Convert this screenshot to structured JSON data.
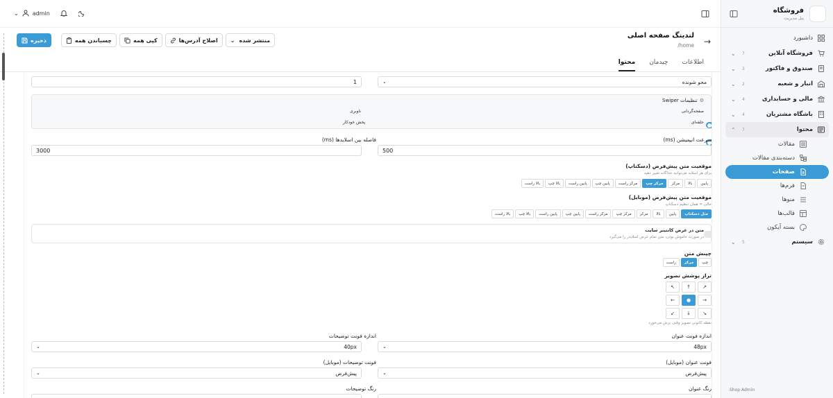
{
  "brand": {
    "name": "فروشگاه",
    "subtitle": "پنل مدیریت"
  },
  "topbar": {
    "username": "admin"
  },
  "sidebar": {
    "top_items": [
      {
        "label": "داشبورد",
        "icon": "grid-icon"
      }
    ],
    "groups": [
      {
        "label": "فروشگاه آنلاین",
        "count": "7"
      },
      {
        "label": "صندوق و فاکتور",
        "count": "3"
      },
      {
        "label": "انبار و شعبه",
        "count": "2"
      },
      {
        "label": "مالی و حسابداری",
        "count": "4"
      },
      {
        "label": "باشگاه مشتریان",
        "count": "4"
      },
      {
        "label": "محتوا",
        "count": "7"
      }
    ],
    "content_items": [
      {
        "label": "مقالات"
      },
      {
        "label": "دسته‌بندی مقالات"
      },
      {
        "label": "صفحات"
      },
      {
        "label": "فرم‌ها"
      },
      {
        "label": "منوها"
      },
      {
        "label": "قالب‌ها"
      },
      {
        "label": "بسته آیکون"
      }
    ],
    "system": {
      "label": "سیستم",
      "count": "5"
    },
    "footer": "Shop Admin"
  },
  "header": {
    "title": "لندینگ صفحه اصلی",
    "path": "/home",
    "status_select": "منتشر شده",
    "fix_urls": "اصلاح آدرس‌ها",
    "copy_all": "کپی همه",
    "paste_all": "چسباندن همه",
    "save": "ذخیره"
  },
  "tabs": [
    "اطلاعات",
    "چیدمان",
    "محتوا"
  ],
  "form": {
    "effect_select": "محو شونده",
    "count_value": "1",
    "swiper_title": "تنظیمات Swiper",
    "pagination_label": "صفحه‌گردانی",
    "navigation_label": "ناوبری",
    "loop_label": "حلقه‌ای",
    "autoplay_label": "پخش خودکار",
    "anim_speed_label": "سرعت انیمیشن (ms)",
    "anim_speed_value": "500",
    "slide_gap_label": "فاصله بین اسلایدها (ms)",
    "slide_gap_value": "3000",
    "desktop_pos_label": "موقعیت متن پیش‌فرض (دسکتاپ)",
    "desktop_pos_hint": "برای هر اسلاید می‌توانید جداگانه تغییر دهید",
    "desktop_positions": [
      "پایین",
      "بالا",
      "مرکز",
      "مرکز چپ",
      "مرکز راست",
      "پایین چپ",
      "پایین راست",
      "بالا چپ",
      "بالا راست"
    ],
    "desktop_active": "مرکز چپ",
    "mobile_pos_label": "موقعیت متن پیش‌فرض (موبایل)",
    "mobile_pos_hint": "خالی = همان تنظیم دسکتاپ",
    "mobile_positions": [
      "مثل دسکتاپ",
      "پایین",
      "بالا",
      "مرکز",
      "مرکز چپ",
      "مرکز راست",
      "پایین چپ",
      "پایین راست",
      "بالا چپ",
      "بالا راست"
    ],
    "mobile_active": "مثل دسکتاپ",
    "container_title": "متن در عرض کانتینر سایت",
    "container_hint": "در صورت خاموش بودن، متن تمام عرض اسلایدر را می‌گیرد",
    "align_label": "چینش متن",
    "align_options": [
      "چپ",
      "مرکز",
      "راست"
    ],
    "align_active": "مرکز",
    "cover_label": "تراز پوشش تصویر",
    "cover_cells": [
      "↖",
      "↑",
      "↗",
      "←",
      "●",
      "→",
      "↙",
      "↓",
      "↘"
    ],
    "cover_hint": "نقطه کانونی تصویر وقتی برش می‌خورد",
    "title_font_label": "اندازه فونت عنوان",
    "title_font_value": "48px",
    "desc_font_label": "اندازه فونت توضیحات",
    "desc_font_value": "40px",
    "title_font_mobile_label": "فونت عنوان (موبایل)",
    "title_font_mobile_value": "پیش‌فرض",
    "desc_font_mobile_label": "فونت توضیحات (موبایل)",
    "desc_font_mobile_value": "پیش‌فرض",
    "title_color_label": "رنگ عنوان",
    "desc_color_label": "رنگ توضیحات"
  },
  "colors": {
    "accent": "#3a9bd5"
  }
}
